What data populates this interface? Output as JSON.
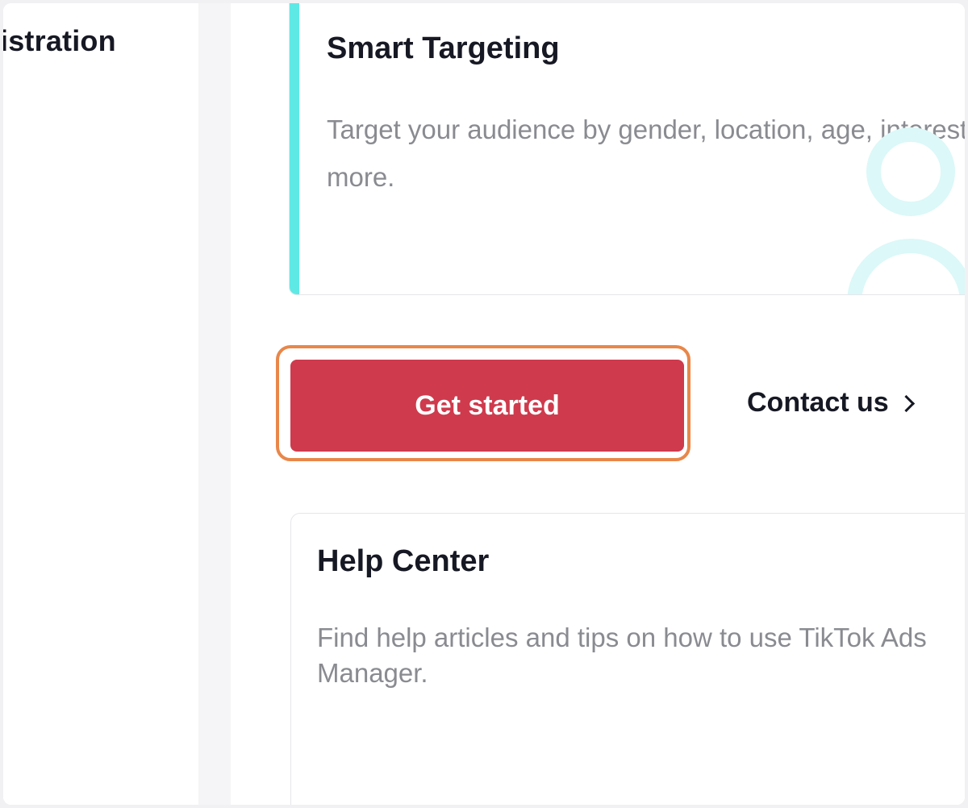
{
  "sidebar": {
    "heading": "istration"
  },
  "feature_card": {
    "title": "Smart Targeting",
    "description": "Target your audience by gender, location, age, interests, and more.",
    "accent_color": "#5ee9e5",
    "illustration_icon": "audience-group-icon"
  },
  "cta": {
    "primary_label": "Get started",
    "primary_color": "#cf3a4d",
    "highlight_color": "#e8874a",
    "secondary_label": "Contact us",
    "secondary_icon": "chevron-right-icon"
  },
  "help_card": {
    "title": "Help Center",
    "description": "Find help articles and tips on how to use TikTok Ads Manager."
  }
}
